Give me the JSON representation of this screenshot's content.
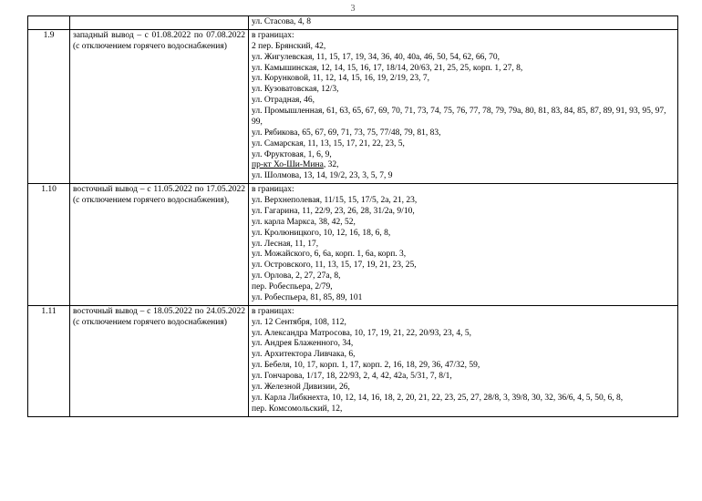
{
  "page_number": "3",
  "rows": [
    {
      "num": "",
      "desc": "",
      "addr": [
        "ул. Стасова, 4, 8"
      ]
    },
    {
      "num": "1.9",
      "desc": "западный вывод – с 01.08.2022 по 07.08.2022 (с отключением горячего водоснабжения)",
      "addr": [
        "в границах:",
        "2 пер. Брянский, 42,",
        "ул. Жигулевская, 11, 15, 17, 19, 34, 36, 40, 40а, 46, 50, 54, 62, 66, 70,",
        "ул. Камышинская, 12, 14, 15, 16, 17, 18/14, 20/63, 21, 25, 25, корп. 1, 27, 8,",
        "ул. Корунковой, 11, 12, 14, 15, 16, 19, 2/19, 23, 7,",
        "ул. Кузоватовская, 12/3,",
        "ул. Отрадная, 46,",
        "ул. Промышленная, 61, 63, 65, 67, 69, 70, 71, 73, 74, 75, 76, 77, 78, 79, 79а, 80, 81, 83, 84, 85, 87, 89, 91, 93, 95, 97, 99,",
        "ул. Рябикова, 65, 67, 69, 71, 73, 75, 77/48, 79, 81, 83,",
        "ул. Самарская, 11, 13, 15, 17, 21, 22, 23, 5,",
        "ул. Фруктовая, 1, 6, 9,",
        "<span class=\"underline\">пр-кт Хо-Ши-Мина</span>, 32,",
        "ул. Шолмова, 13, 14, 19/2, 23, 3, 5, 7, 9"
      ]
    },
    {
      "num": "1.10",
      "desc": "восточный вывод – с 11.05.2022 по 17.05.2022 (с отключением горячего водоснабжения),",
      "addr": [
        "в границах:",
        "ул. Верхнеполевая, 11/15, 15, 17/5, 2а, 21, 23,",
        "ул. Гагарина, 11, 22/9, 23, 26, 28, 31/2а, 9/10,",
        "ул. карла Маркса, 38, 42, 52,",
        "ул. Кролюницкого, 10, 12, 16, 18, 6, 8,",
        "ул. Лесная, 11, 17,",
        "ул. Можайского, 6, 6а, корп. 1, 6а, корп. 3,",
        "ул. Островского, 11, 13, 15, 17, 19, 21, 23, 25,",
        "ул. Орлова, 2, 27, 27а, 8,",
        "пер. Робеспьера, 2/79,",
        "ул. Робеспьера, 81, 85, 89, 101"
      ]
    },
    {
      "num": "1.11",
      "desc": "восточный вывод – с 18.05.2022 по 24.05.2022 (с отключением горячего водоснабжения)",
      "addr": [
        "в границах:",
        "ул. 12 Сентября, 108, 112,",
        "ул. Александра Матросова, 10, 17, 19, 21, 22, 20/93, 23, 4, 5,",
        "ул. Андрея Блаженного, 34,",
        "ул. Архитектора Ливчака, 6,",
        "ул. Бебеля, 10, 17, корп. 1, 17, корп. 2, 16, 18, 29, 36, 47/32, 59,",
        "ул. Гончарова, 1/17, 18, 22/93, 2, 4, 42, 42а, 5/31, 7, 8/1,",
        "ул. Железной Дивизии, 26,",
        "ул. Карла Либкнехта, 10, 12, 14, 16, 18, 2, 20, 21, 22, 23, 25, 27, 28/8, 3, 39/8, 30, 32, 36/6, 4, 5, 50, 6, 8,",
        "пер. Комсомольский, 12,"
      ]
    }
  ]
}
